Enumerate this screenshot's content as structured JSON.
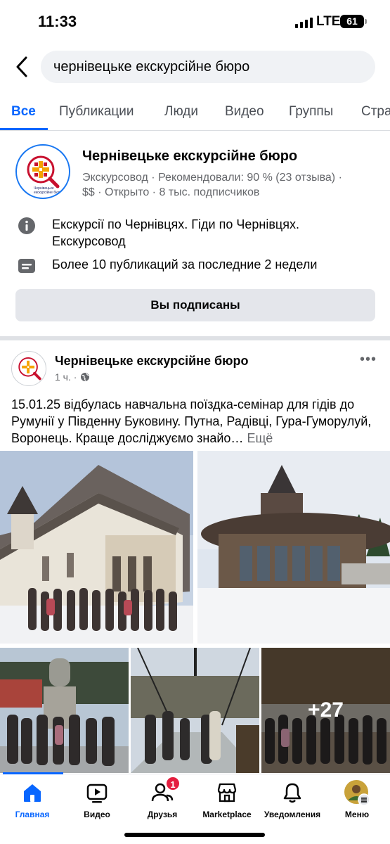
{
  "status_bar": {
    "time": "11:33",
    "network": "LTE",
    "battery": "61"
  },
  "search": {
    "query": "чернівецьке екскурсійне бюро"
  },
  "tabs": [
    {
      "label": "Все"
    },
    {
      "label": "Публикации"
    },
    {
      "label": "Люди"
    },
    {
      "label": "Видео"
    },
    {
      "label": "Группы"
    },
    {
      "label": "Стра"
    }
  ],
  "page_result": {
    "name": "Чернівецьке екскурсійне бюро",
    "logo_text": "Чернівецьке екскурсійне бюро",
    "meta_line1": "Экскурсовод · Рекомендовали: 90 % (23 отзыва) ·",
    "meta_line2": "$$ · Открыто · 8 тыс. подписчиков",
    "about": "Екскурсії по Чернівцях. Гіди по Чернівцях. Екскурсовод",
    "activity": "Более 10 публикаций за последние 2 недели",
    "subscribe_button": "Вы подписаны"
  },
  "post": {
    "author": "Чернівецьке екскурсійне бюро",
    "time": "1 ч. ·",
    "text": "15.01.25 відбулась навчальна поїздка-семінар для гідів до Румунії у Південну Буковину. Путна, Радівці, Гура-Гуморулуй, Воронець. Краще досліджуємо знайо…",
    "more_link": "Ещё",
    "extra_photos": "+27"
  },
  "bottom_nav": [
    {
      "label": "Главная",
      "icon": "home-icon"
    },
    {
      "label": "Видео",
      "icon": "video-icon"
    },
    {
      "label": "Друзья",
      "icon": "friends-icon",
      "badge": "1"
    },
    {
      "label": "Marketplace",
      "icon": "marketplace-icon"
    },
    {
      "label": "Уведомления",
      "icon": "bell-icon"
    },
    {
      "label": "Меню",
      "icon": "menu-avatar-icon"
    }
  ],
  "colors": {
    "accent": "#0866ff",
    "badge": "#e41e3f",
    "text": "#050505",
    "secondary": "#65676b"
  }
}
